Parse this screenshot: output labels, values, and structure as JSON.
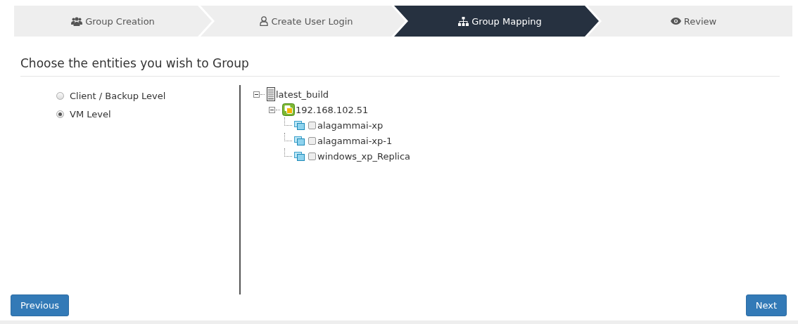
{
  "steps": [
    {
      "label": "Group Creation",
      "selected": false
    },
    {
      "label": "Create User Login",
      "selected": false
    },
    {
      "label": "Group Mapping",
      "selected": true
    },
    {
      "label": "Review",
      "selected": false
    }
  ],
  "heading": "Choose the entities you wish to Group",
  "levels": [
    {
      "label": "Client / Backup Level",
      "selected": false
    },
    {
      "label": "VM Level",
      "selected": true
    }
  ],
  "tree": [
    {
      "kind": "server",
      "label": "latest_build",
      "expanded": true,
      "children": [
        {
          "kind": "host",
          "label": "192.168.102.51",
          "expanded": true,
          "children": [
            {
              "kind": "vm",
              "label": "alagammai-xp",
              "checked": false
            },
            {
              "kind": "vm",
              "label": "alagammai-xp-1",
              "checked": false
            },
            {
              "kind": "vm",
              "label": "windows_xp_Replica",
              "checked": false
            }
          ]
        }
      ]
    }
  ],
  "buttons": {
    "previous": "Previous",
    "next": "Next"
  }
}
